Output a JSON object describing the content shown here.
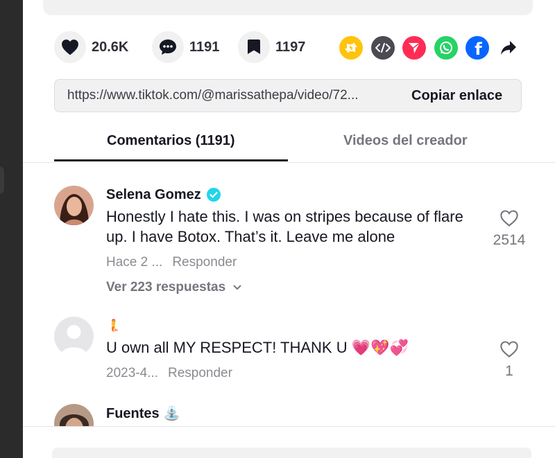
{
  "stats": {
    "likes": "20.6K",
    "comments": "1191",
    "saves": "1197"
  },
  "share_icons": [
    "repost-icon",
    "embed-icon",
    "send-icon",
    "whatsapp-icon",
    "facebook-icon",
    "share-arrow-icon"
  ],
  "colors": {
    "repost": "#ffc30b",
    "embed": "#4a4b53",
    "send": "#fe2c55",
    "whatsapp": "#25d366",
    "facebook": "#0866ff",
    "verified": "#20d5ec"
  },
  "link": {
    "url": "https://www.tiktok.com/@marissathepa/video/72...",
    "copy_label": "Copiar enlace"
  },
  "tabs": [
    {
      "label": "Comentarios (1191)",
      "active": true
    },
    {
      "label": "Videos del creador",
      "active": false
    }
  ],
  "comments": [
    {
      "username": "Selena Gomez",
      "verified": true,
      "text": "Honestly I hate this. I was on stripes because of flare up. I have Botox. That’s it. Leave me alone",
      "time": "Hace 2 ...",
      "reply_label": "Responder",
      "likes": "2514",
      "view_replies": "Ver 223 respuestas"
    },
    {
      "username": "🧜",
      "verified": false,
      "text": "U own all MY RESPECT! THANK U 💗💖💞",
      "time": "2023-4...",
      "reply_label": "Responder",
      "likes": "1"
    },
    {
      "username": "Fuentes ⛲",
      "verified": false
    }
  ]
}
